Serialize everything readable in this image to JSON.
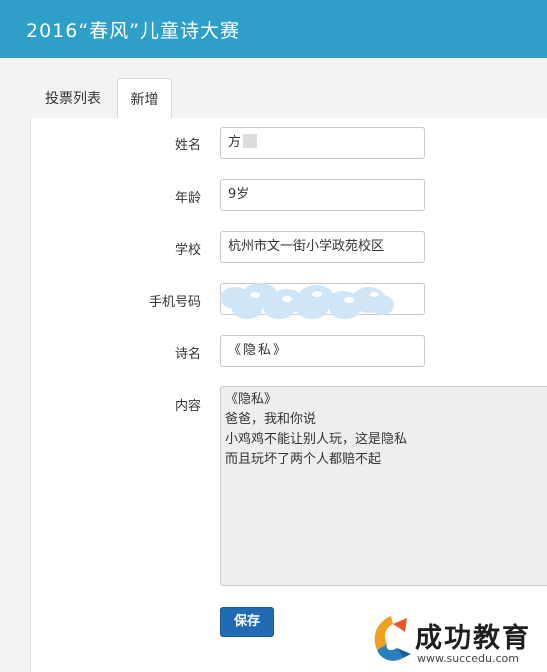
{
  "header": {
    "title": "2016“春风”儿童诗大赛"
  },
  "tabs": [
    {
      "label": "投票列表"
    },
    {
      "label": "新增"
    }
  ],
  "form": {
    "name": {
      "label": "姓名",
      "value": "方"
    },
    "age": {
      "label": "年龄",
      "value": "9岁"
    },
    "school": {
      "label": "学校",
      "value": "杭州市文一街小学政苑校区"
    },
    "phone": {
      "label": "手机号码"
    },
    "poem_title": {
      "label": "诗名",
      "value": "《隐私》"
    },
    "content": {
      "label": "内容",
      "value": "《隐私》\n爸爸，我和你说\n小鸡鸡不能让别人玩，这是隐私\n而且玩坏了两个人都赔不起"
    },
    "save_label": "保存"
  },
  "watermark": {
    "text": "成功教育",
    "url": "www.succedu.com"
  },
  "colors": {
    "header": "#2e9fc8",
    "save_button": "#1f6cb4"
  }
}
